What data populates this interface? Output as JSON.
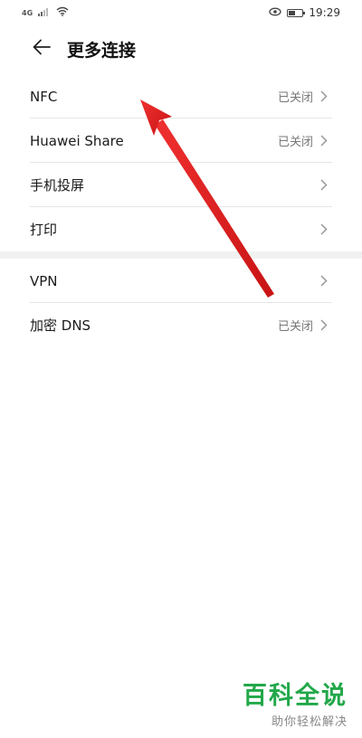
{
  "status_bar": {
    "network_label": "4G",
    "time": "19:29"
  },
  "header": {
    "title": "更多连接"
  },
  "items": [
    {
      "label": "NFC",
      "status": "已关闭"
    },
    {
      "label": "Huawei Share",
      "status": "已关闭"
    },
    {
      "label": "手机投屏",
      "status": ""
    },
    {
      "label": "打印",
      "status": ""
    },
    {
      "label": "VPN",
      "status": ""
    },
    {
      "label": "加密 DNS",
      "status": "已关闭"
    }
  ],
  "colors": {
    "arrow": "#e11d1d",
    "watermark": "#22a84a"
  },
  "icons": {
    "back": "arrow-left-icon",
    "chevron": "chevron-right-icon"
  },
  "watermark": {
    "title": "百科全说",
    "subtitle": "助你轻松解决"
  }
}
